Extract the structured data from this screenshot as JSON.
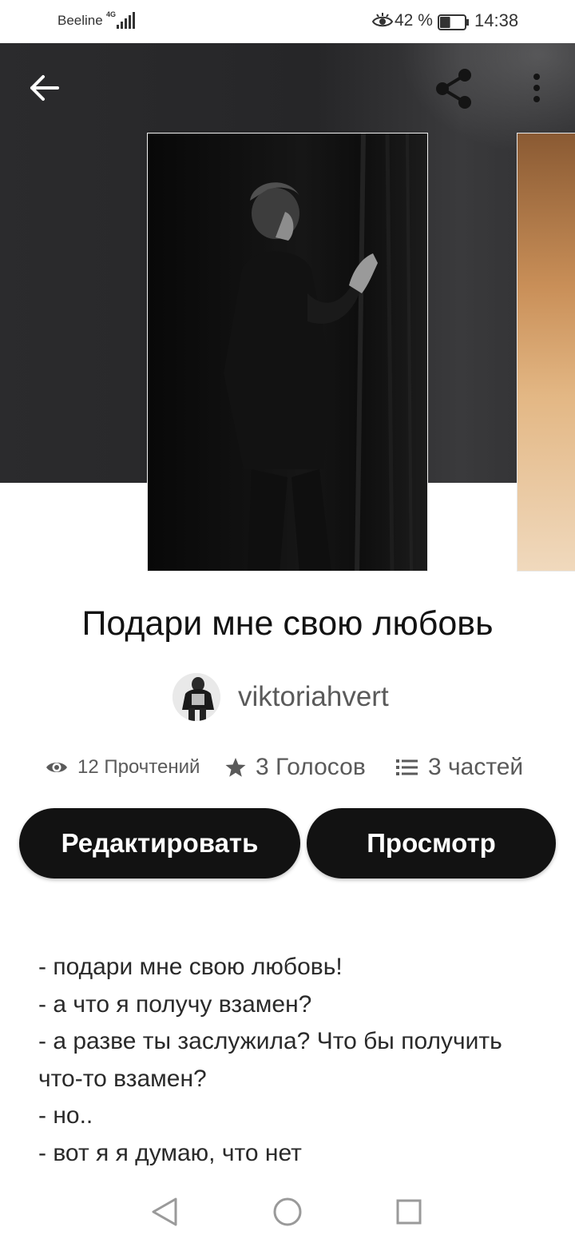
{
  "status_bar": {
    "carrier": "Beeline",
    "network": "4G",
    "battery_percent": "42 %",
    "time": "14:38",
    "battery_level": 0.42
  },
  "header": {
    "back_icon": "arrow-left-icon",
    "share_icon": "share-icon",
    "more_icon": "more-vertical-icon"
  },
  "story": {
    "title": "Подари мне свою любовь",
    "author": "viktoriahvert",
    "stats": {
      "reads": "12 Прочтений",
      "votes": "3 Голосов",
      "parts": "3 частей"
    },
    "buttons": {
      "edit": "Редактировать",
      "view": "Просмотр"
    },
    "description_lines": [
      "- подари мне свою любовь!",
      "- а что я получу взамен?",
      "- а разве ты заслужила? Что бы получить",
      "что-то взамен?",
      "- но..",
      "- вот я я думаю, что нет"
    ]
  },
  "nav_bar": {
    "back_icon": "triangle-back-icon",
    "home_icon": "circle-home-icon",
    "recents_icon": "square-recents-icon"
  },
  "colors": {
    "hero_bg": "#2b2b2d",
    "button_bg": "#121212",
    "button_text": "#ffffff",
    "muted_text": "#5a5a5a"
  }
}
